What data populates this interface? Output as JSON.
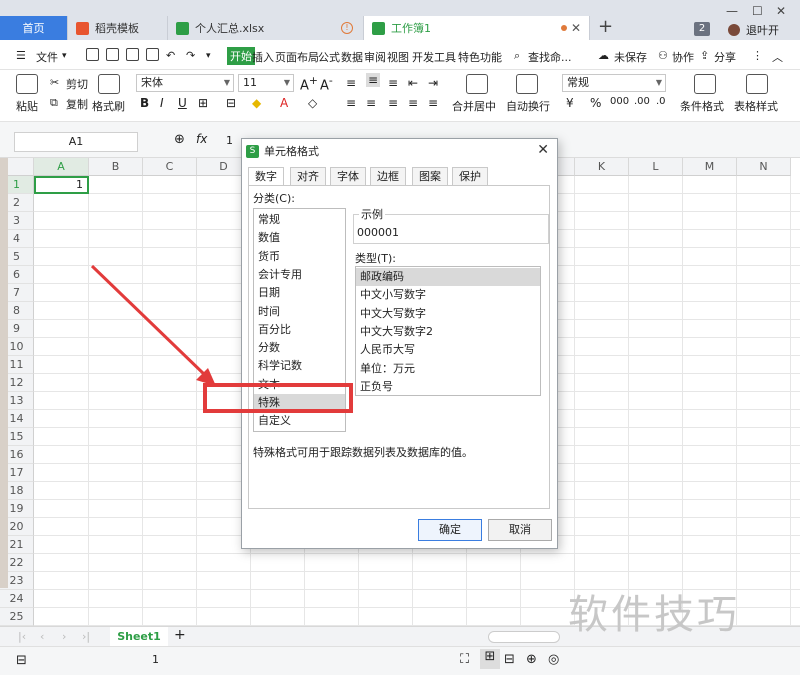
{
  "tabs": [
    {
      "label": "首页"
    },
    {
      "label": "稻壳模板"
    },
    {
      "label": "个人汇总.xlsx"
    },
    {
      "label": "工作簿1"
    }
  ],
  "window": {
    "badge": "2",
    "user": "退叶开"
  },
  "menu": {
    "file": "文件",
    "items": [
      "开始",
      "插入",
      "页面布局",
      "公式",
      "数据",
      "审阅",
      "视图",
      "开发工具",
      "特色功能"
    ],
    "search": "查找命...",
    "unsaved": "未保存",
    "collab": "协作",
    "share": "分享"
  },
  "ribbon": {
    "cut": "剪切",
    "copy": "复制",
    "paste": "粘贴",
    "format_painter": "格式刷",
    "font": "宋体",
    "size": "11",
    "number_format": "常规",
    "merge": "合并居中",
    "wrap": "自动换行",
    "cond_format": "条件格式",
    "table_style": "表格样式"
  },
  "formula": {
    "namebox": "A1",
    "fx": "fx",
    "value": "1"
  },
  "grid": {
    "columns": [
      "A",
      "B",
      "C",
      "D",
      "E",
      "F",
      "G",
      "H",
      "I",
      "J",
      "K",
      "L",
      "M",
      "N"
    ],
    "rows": [
      "1",
      "2",
      "3",
      "4",
      "5",
      "6",
      "7",
      "8",
      "9",
      "10",
      "11",
      "12",
      "13",
      "14",
      "15",
      "16",
      "17",
      "18",
      "19",
      "20",
      "21",
      "22",
      "23",
      "24",
      "25",
      "26"
    ],
    "a1_value": "1"
  },
  "sheets": {
    "active": "Sheet1",
    "status_value": "1"
  },
  "dialog": {
    "title": "单元格格式",
    "tabs": [
      "数字",
      "对齐",
      "字体",
      "边框",
      "图案",
      "保护"
    ],
    "category_label": "分类(C):",
    "categories": [
      "常规",
      "数值",
      "货币",
      "会计专用",
      "日期",
      "时间",
      "百分比",
      "分数",
      "科学记数",
      "文本",
      "特殊",
      "自定义"
    ],
    "selected_category": "特殊",
    "sample_label": "示例",
    "sample_value": "000001",
    "type_label": "类型(T):",
    "types": [
      "邮政编码",
      "中文小写数字",
      "中文大写数字",
      "中文大写数字2",
      "人民币大写",
      "单位：万元",
      "正负号"
    ],
    "selected_type": "邮政编码",
    "description": "特殊格式可用于跟踪数据列表及数据库的值。",
    "ok": "确定",
    "cancel": "取消"
  },
  "watermark": "软件技巧",
  "colors": {
    "accent_green": "#2e9e46",
    "home_blue": "#3a7de0",
    "annotation_red": "#e23b3b"
  }
}
